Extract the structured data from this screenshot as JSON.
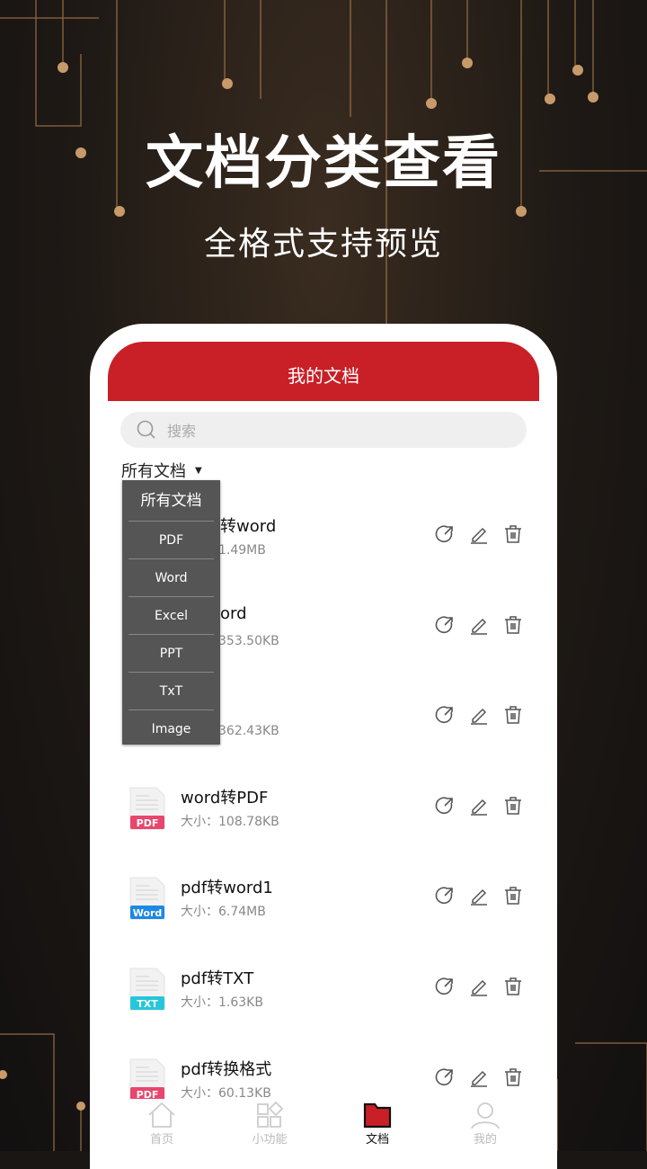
{
  "hero": {
    "title": "文档分类查看",
    "subtitle": "全格式支持预览"
  },
  "app": {
    "header_title": "我的文档",
    "search_placeholder": "搜索",
    "filter_label": "所有文档",
    "size_label": "大小："
  },
  "filter_menu": [
    "所有文档",
    "PDF",
    "Word",
    "Excel",
    "PPT",
    "TxT",
    "Image"
  ],
  "files": [
    {
      "name": "转word",
      "size": "1.49MB",
      "type": "PDF",
      "partial": true
    },
    {
      "name": "ord",
      "size": "353.50KB",
      "type": "PDF",
      "partial": true
    },
    {
      "name": "",
      "size": "362.43KB",
      "type": "PDF",
      "partial": true
    },
    {
      "name": "word转PDF",
      "size": "108.78KB",
      "type": "PDF"
    },
    {
      "name": "pdf转word1",
      "size": "6.74MB",
      "type": "Word"
    },
    {
      "name": "pdf转TXT",
      "size": "1.63KB",
      "type": "TXT"
    },
    {
      "name": "pdf转换格式",
      "size": "60.13KB",
      "type": "PDF"
    }
  ],
  "badge_colors": {
    "PDF": "#e8466e",
    "Word": "#1e88e5",
    "TXT": "#26c6da"
  },
  "tabs": [
    {
      "label": "首页",
      "icon": "home-icon"
    },
    {
      "label": "小功能",
      "icon": "grid-icon"
    },
    {
      "label": "文档",
      "icon": "folder-icon",
      "active": true
    },
    {
      "label": "我的",
      "icon": "user-icon"
    }
  ],
  "accent": "#c91f26"
}
